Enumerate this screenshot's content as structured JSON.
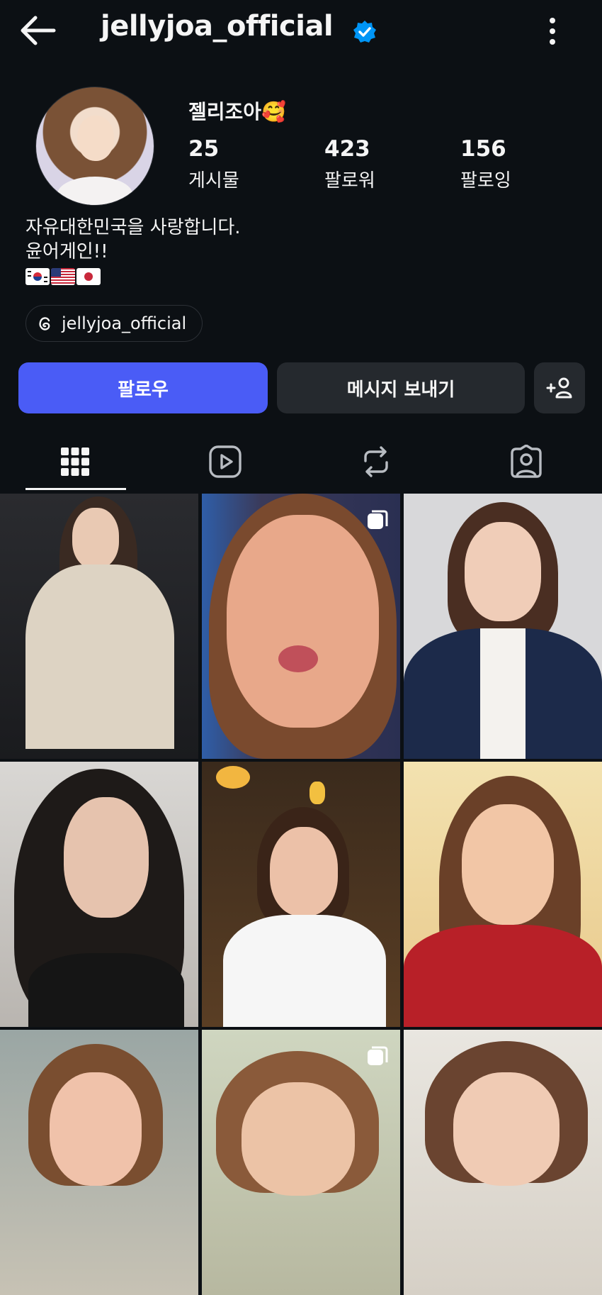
{
  "header": {
    "username": "jellyjoa_official",
    "back_icon": "arrow-left-icon",
    "verified_icon": "verified-badge-icon",
    "more_icon": "more-vertical-icon"
  },
  "profile": {
    "display_name": "젤리조아🥰",
    "stats": [
      {
        "value": "25",
        "label": "게시물"
      },
      {
        "value": "423",
        "label": "팔로워"
      },
      {
        "value": "156",
        "label": "팔로잉"
      }
    ],
    "bio_lines": [
      "자유대한민국을 사랑합니다.",
      "윤어게인!!"
    ],
    "flags": [
      "🇰🇷",
      "🇺🇸",
      "🇯🇵"
    ],
    "threads_handle": "jellyjoa_official"
  },
  "actions": {
    "follow_label": "팔로우",
    "message_label": "메시지 보내기",
    "add_icon": "add-person-icon"
  },
  "tabs": [
    {
      "icon": "grid-icon",
      "selected": true
    },
    {
      "icon": "reels-icon",
      "selected": false
    },
    {
      "icon": "repost-icon",
      "selected": false
    },
    {
      "icon": "tagged-icon",
      "selected": false
    }
  ],
  "colors": {
    "background": "#0c1014",
    "follow_button": "#4a5cf6",
    "secondary_button": "#25292e",
    "verified": "#0095f6"
  }
}
